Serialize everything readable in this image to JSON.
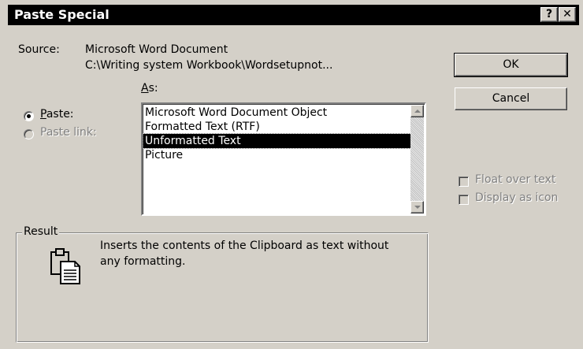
{
  "window": {
    "title": "Paste Special",
    "help_label": "?",
    "close_label": "✕"
  },
  "source": {
    "label": "Source:",
    "line1": "Microsoft Word Document",
    "line2": "C:\\Writing system Workbook\\Wordsetupnot..."
  },
  "as_label": {
    "hotkey": "A",
    "rest": "s:"
  },
  "options": {
    "paste": {
      "hotkey": "P",
      "rest": "aste:",
      "selected": true
    },
    "paste_link": {
      "label": "Paste link:",
      "selected": false,
      "disabled": true
    }
  },
  "list": {
    "items": [
      "Microsoft Word Document Object",
      "Formatted Text (RTF)",
      "Unformatted Text",
      "Picture"
    ],
    "selected_index": 2
  },
  "buttons": {
    "ok": "OK",
    "cancel": "Cancel"
  },
  "checkboxes": {
    "float_over_text": {
      "label": "Float over text",
      "checked": false,
      "disabled": true
    },
    "display_as_icon": {
      "label": "Display as icon",
      "checked": false,
      "disabled": true
    }
  },
  "result": {
    "label": "Result",
    "line1": "Inserts the contents of the Clipboard as text without",
    "line2": "any formatting.",
    "icon": "clipboard-paste-icon"
  }
}
